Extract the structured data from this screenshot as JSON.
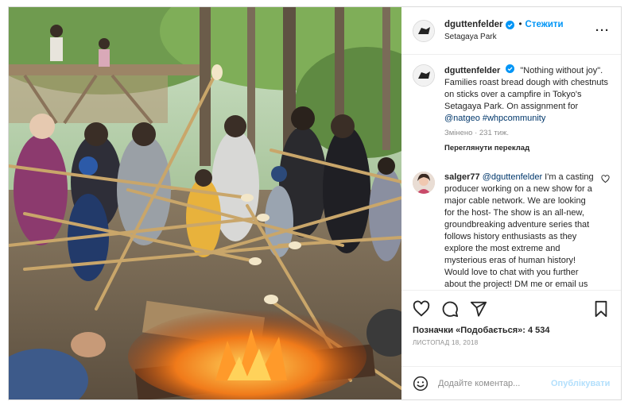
{
  "post": {
    "username": "dguttenfelder",
    "follow_label": "Стежити",
    "dot": "•",
    "location": "Setagaya Park",
    "more_label": "···"
  },
  "caption": {
    "username": "dguttenfelder",
    "text_part1": "\"Nothing without joy\". Families roast bread dough with chestnuts on sticks over a campfire in Tokyo's Setagaya Park. On assignment for ",
    "mention": "@natgeo",
    "hashtag": "#whpcommunity",
    "meta": "Змінено · 231 тиж.",
    "translate_label": "Переглянути переклад"
  },
  "comment": {
    "username": "salger77",
    "mention": "@dguttenfelder",
    "text": "I'm a casting producer working on a new show for a major cable network. We are looking for the host- The show is an all-new, groundbreaking adventure series that follows history enthusiasts as they explore the most extreme and mysterious eras of human history! Would love to chat with you further about the project! DM me or email us at"
  },
  "actions": {
    "likes_label": "Позначки «Подобається»: 4 534",
    "date": "ЛИСТОПАД 18, 2018"
  },
  "add_comment": {
    "placeholder": "Додайте коментар...",
    "publish_label": "Опублікувати"
  },
  "icons": {
    "verified": "verified-badge-icon",
    "heart": "heart-icon",
    "comment": "comment-icon",
    "share": "share-icon",
    "bookmark": "bookmark-icon",
    "emoji": "emoji-icon"
  },
  "colors": {
    "accent": "#0095f6",
    "verified": "#0095f6",
    "link": "#00376b",
    "muted": "#8e8e8e",
    "publish_disabled": "#b2dffc"
  }
}
